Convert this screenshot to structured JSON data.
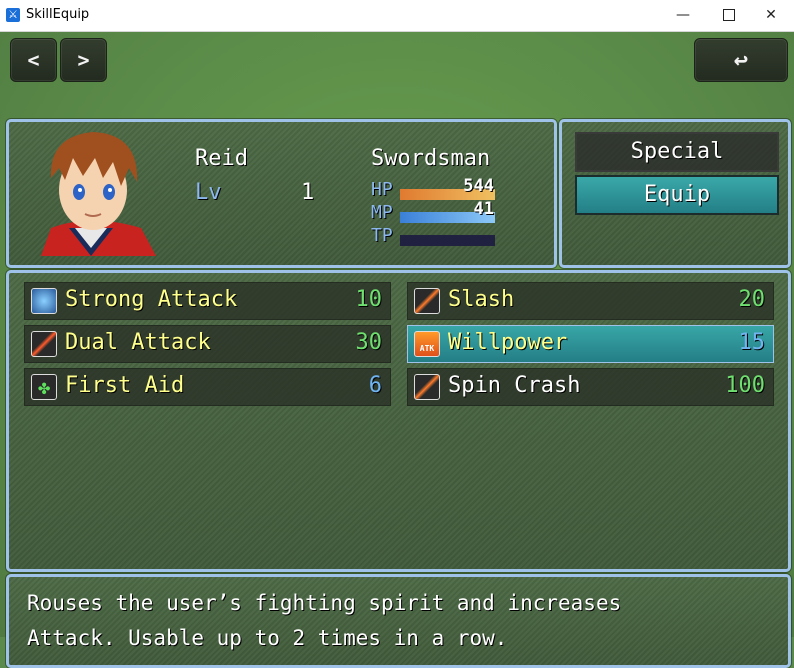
{
  "window": {
    "title": "SkillEquip"
  },
  "nav": {
    "prev_label": "<",
    "next_label": ">",
    "back_label": "↩"
  },
  "actor": {
    "name": "Reid",
    "class": "Swordsman",
    "level_label": "Lv",
    "level": "1",
    "hp_label": "HP",
    "hp_value": "544",
    "hp_fill": 1.0,
    "hp_color": "#e8a048",
    "mp_label": "MP",
    "mp_value": "41",
    "mp_fill": 1.0,
    "mp_color": "#5aa0e6",
    "tp_label": "TP",
    "tp_value": "",
    "tp_fill": 0.0
  },
  "commands": [
    {
      "label": "Special",
      "selected": false
    },
    {
      "label": "Equip",
      "selected": true
    }
  ],
  "skills": [
    {
      "name": "Strong Attack",
      "cost": "10",
      "icon": "fist-icon",
      "cost_type": "tp",
      "selected": false,
      "known": true
    },
    {
      "name": "Slash",
      "cost": "20",
      "icon": "sword-icon",
      "cost_type": "tp",
      "selected": false,
      "known": true
    },
    {
      "name": "Dual Attack",
      "cost": "30",
      "icon": "sword-icon",
      "cost_type": "tp",
      "selected": false,
      "known": true
    },
    {
      "name": "Willpower",
      "cost": "15",
      "icon": "attack-up-icon",
      "cost_type": "mp",
      "selected": true,
      "known": true
    },
    {
      "name": "First Aid",
      "cost": "6",
      "icon": "clover-icon",
      "cost_type": "mp",
      "selected": false,
      "known": true
    },
    {
      "name": "Spin Crash",
      "cost": "100",
      "icon": "sword-icon",
      "cost_type": "tp",
      "selected": false,
      "known": false
    }
  ],
  "help": {
    "line1": "Rouses the user’s fighting spirit and increases",
    "line2": "Attack. Usable up to 2 times in a row."
  }
}
